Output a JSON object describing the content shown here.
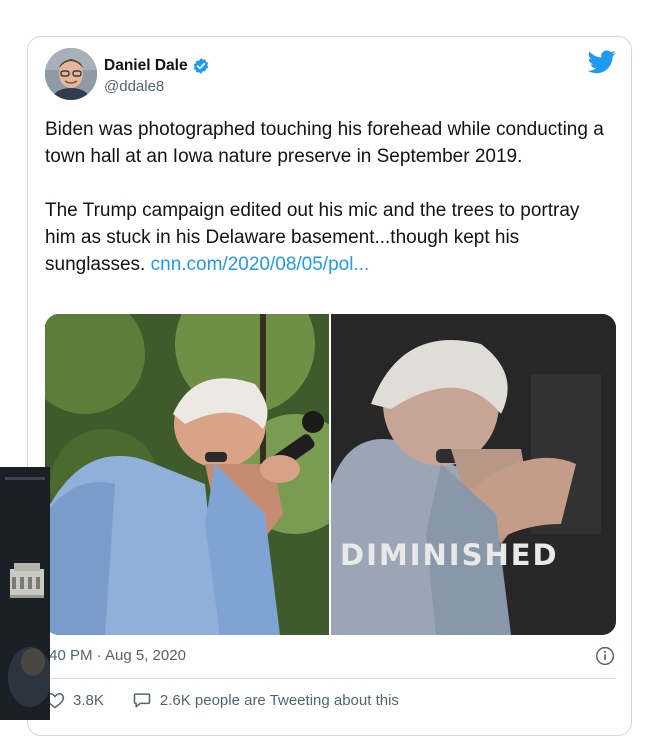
{
  "tweet": {
    "author_name": "Daniel Dale",
    "author_handle": "@ddale8",
    "paragraph1": "Biden was photographed touching his forehead while conducting a town hall at an Iowa nature preserve in September 2019.",
    "paragraph2": "The Trump campaign edited out his mic and the trees to portray him as stuck in his Delaware basement...though kept his sunglasses.",
    "link_text": "cnn.com/2020/08/05/pol...",
    "media_caption": "DIMINISHED",
    "timestamp": ":40 PM · Aug 5, 2020",
    "likes": "3.8K",
    "conversation": "2.6K people are Tweeting about this"
  },
  "icons": {
    "verified": "verified-badge-icon",
    "brand": "twitter-bird-icon",
    "info": "info-icon",
    "like": "heart-icon",
    "reply": "speech-bubble-icon"
  },
  "colors": {
    "accent": "#1d9bf0",
    "text": "#0f1419",
    "muted": "#536471",
    "border": "#cfd9de"
  }
}
